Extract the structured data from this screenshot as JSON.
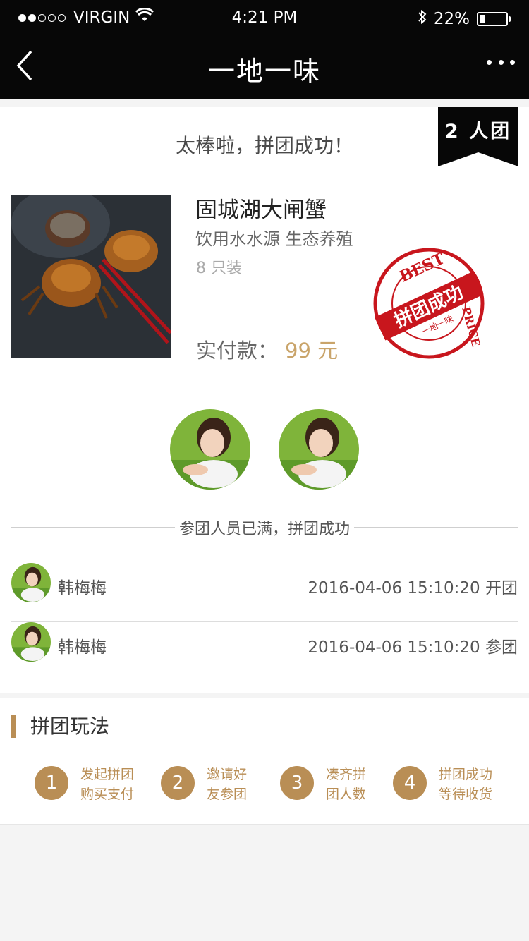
{
  "status_bar": {
    "carrier": "VIRGIN",
    "time": "4:21 PM",
    "battery": "22%",
    "battery_level": 0.22,
    "signal_bars": 2
  },
  "nav": {
    "title": "一地一味",
    "back_icon": "chevron-left-icon",
    "more_icon": "more-dots-icon"
  },
  "success": {
    "headline": "太棒啦，拼团成功！",
    "group_badge": "2 人团"
  },
  "product": {
    "name": "固城湖大闸蟹",
    "description": "饮用水水源 生态养殖",
    "spec": "8 只装",
    "price_label": "实付款：",
    "price_value": "99 元",
    "stamp": {
      "top_text": "BEST",
      "side_text": "PRICE",
      "banner_text": "拼团成功",
      "brand_text": "一地一味"
    }
  },
  "participants": {
    "full_text": "参团人员已满，拼团成功",
    "members": [
      {
        "name": "韩梅梅",
        "time": "2016-04-06 15:10:20",
        "action": "开团"
      },
      {
        "name": "韩梅梅",
        "time": "2016-04-06 15:10:20",
        "action": "参团"
      }
    ]
  },
  "rules": {
    "title": "拼团玩法",
    "steps": [
      {
        "num": "1",
        "line1": "发起拼团",
        "line2": "购买支付"
      },
      {
        "num": "2",
        "line1": "邀请好",
        "line2": "友参团"
      },
      {
        "num": "3",
        "line1": "凑齐拼",
        "line2": "团人数"
      },
      {
        "num": "4",
        "line1": "拼团成功",
        "line2": "等待收货"
      }
    ]
  },
  "colors": {
    "accent": "#b98e55",
    "price": "#c9a46a",
    "stamp_red": "#c8161d",
    "header_bg": "#070707"
  }
}
